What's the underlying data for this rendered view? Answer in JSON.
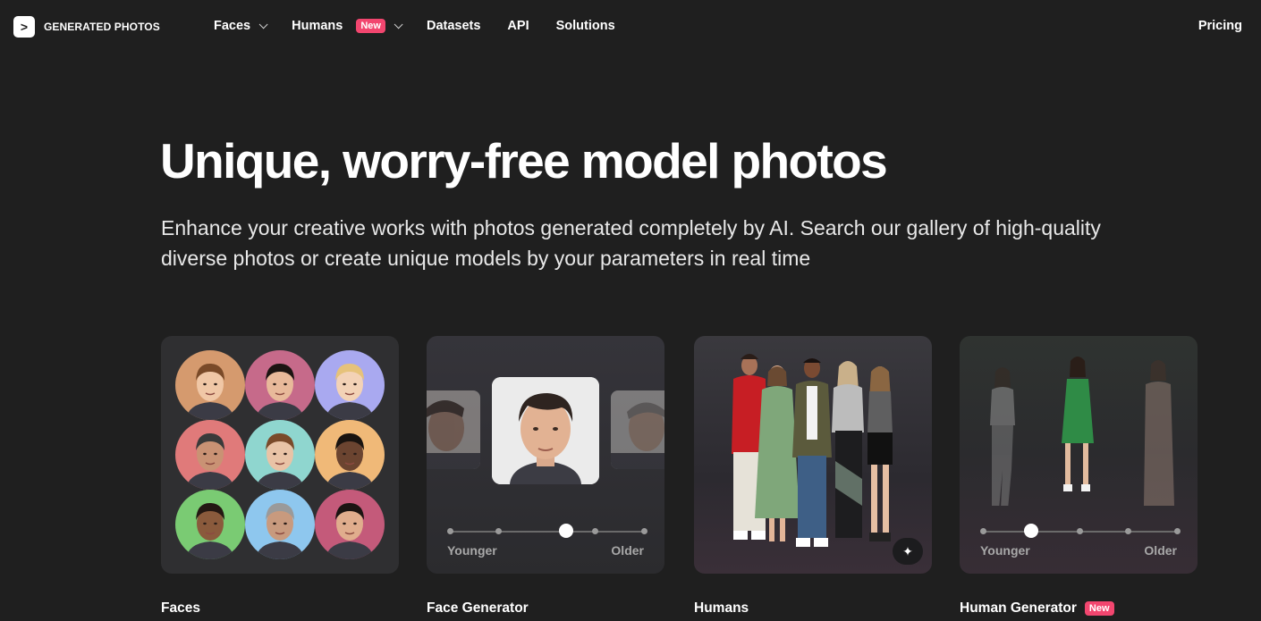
{
  "brand": {
    "name": "GENERATED PHOTOS",
    "logo_glyph": ">"
  },
  "nav": {
    "items": [
      {
        "label": "Faces",
        "has_dropdown": true
      },
      {
        "label": "Humans",
        "badge": "New",
        "has_dropdown": true
      },
      {
        "label": "Datasets"
      },
      {
        "label": "API"
      },
      {
        "label": "Solutions"
      }
    ],
    "pricing": "Pricing"
  },
  "hero": {
    "title": "Unique, worry-free model photos",
    "subtitle": "Enhance your creative works with photos generated completely by AI. Search our gallery of high-quality diverse photos or create unique models by your parameters in real time"
  },
  "cards": [
    {
      "title": "Faces"
    },
    {
      "title": "Face Generator",
      "slider_min": "Younger",
      "slider_max": "Older",
      "slider_value": 0.6
    },
    {
      "title": "Humans",
      "action_icon": "magic-wand-icon"
    },
    {
      "title": "Human Generator",
      "badge": "New",
      "slider_min": "Younger",
      "slider_max": "Older",
      "slider_value": 0.25
    }
  ],
  "colors": {
    "background": "#1f1f1f",
    "badge": "#f2466f",
    "face_backgrounds": [
      "#d59a6e",
      "#c66a8a",
      "#a9a9f0",
      "#e07a7a",
      "#8fd6cf",
      "#f0b978",
      "#7acb73",
      "#8ec7ee",
      "#c45a7a"
    ]
  }
}
